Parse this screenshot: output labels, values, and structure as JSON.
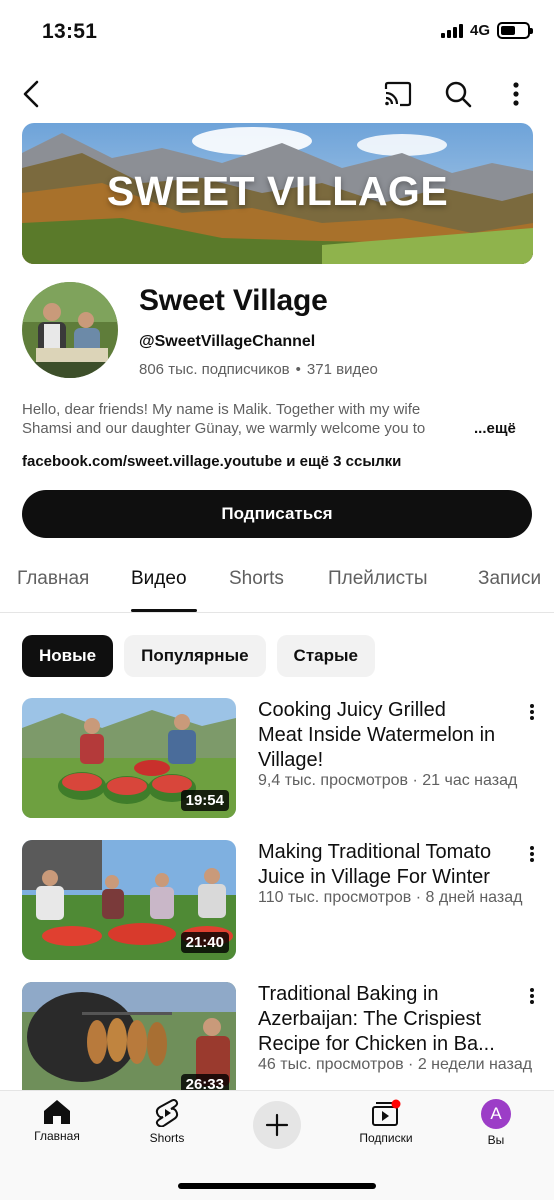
{
  "status_bar": {
    "time": "13:51",
    "network": "4G"
  },
  "top_bar": {
    "icons": [
      "back-icon",
      "cast-icon",
      "search-icon",
      "more-vertical-icon"
    ]
  },
  "banner": {
    "title": "SWEET VILLAGE"
  },
  "channel": {
    "name": "Sweet Village",
    "handle": "@SweetVillageChannel",
    "subscribers": "806 тыс. подписчиков",
    "separator": "•",
    "videos": "371 видео",
    "description_line1": "Hello, dear friends! My name is Malik. Together with my wife",
    "description_line2": "Shamsi and our daughter Günay, we warmly welcome you to",
    "description_more": "...ещё",
    "links": "facebook.com/sweet.village.youtube и ещё 3 ссылки",
    "subscribe_label": "Подписаться"
  },
  "tabs": [
    "Главная",
    "Видео",
    "Shorts",
    "Плейлисты",
    "Записи"
  ],
  "active_tab": "Видео",
  "chips": [
    "Новые",
    "Популярные",
    "Старые"
  ],
  "active_chip": "Новые",
  "videos": [
    {
      "title_lines": [
        "Cooking Juicy Grilled",
        "Meat Inside Watermelon in",
        "Village!"
      ],
      "meta": "9,4 тыс. просмотров · 21 час назад",
      "duration": "19:54"
    },
    {
      "title_lines": [
        "Making Traditional Tomato",
        "Juice in Village For Winter"
      ],
      "meta": "110 тыс. просмотров · 8 дней назад",
      "duration": "21:40"
    },
    {
      "title_lines": [
        "Traditional Baking in",
        "Azerbaijan: The Crispiest",
        "Recipe for Chicken in Ba..."
      ],
      "meta": "46 тыс. просмотров · 2 недели назад",
      "duration": "26:33"
    }
  ],
  "bottom_nav": {
    "home": "Главная",
    "shorts": "Shorts",
    "subscriptions": "Подписки",
    "you": "Вы",
    "you_avatar_letter": "A"
  },
  "colors": {
    "accent_dark": "#0f0f0f",
    "secondary_text": "#606060",
    "notification_dot": "#ff0000",
    "avatar_bg": "#9c3dc7"
  }
}
